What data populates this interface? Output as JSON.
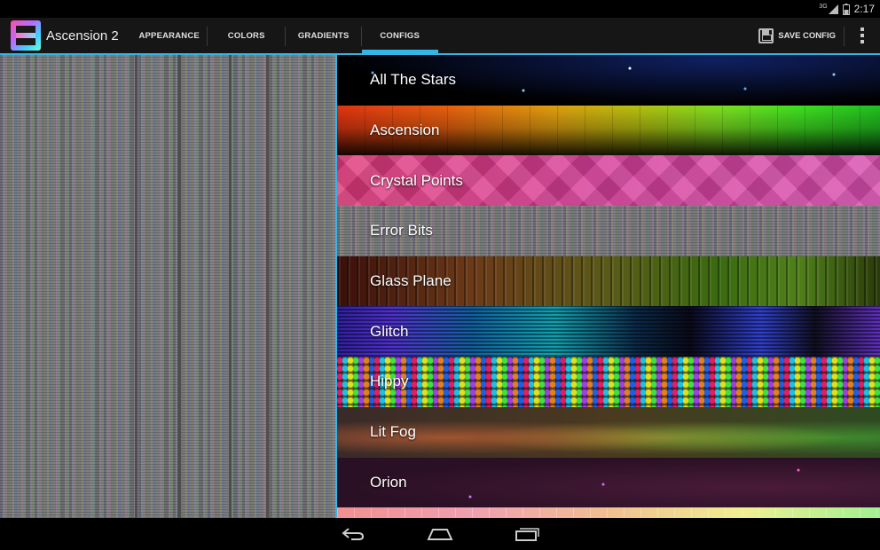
{
  "status_bar": {
    "network": "3G",
    "time": "2:17"
  },
  "action_bar": {
    "app_title": "Ascension 2",
    "tabs": [
      {
        "label": "APPEARANCE",
        "active": false
      },
      {
        "label": "COLORS",
        "active": false
      },
      {
        "label": "GRADIENTS",
        "active": false
      },
      {
        "label": "CONFIGS",
        "active": true
      }
    ],
    "save_label": "SAVE CONFIG",
    "accent_color": "#33b5e5"
  },
  "configs": [
    {
      "label": "All The Stars"
    },
    {
      "label": "Ascension"
    },
    {
      "label": "Crystal Points"
    },
    {
      "label": "Error Bits"
    },
    {
      "label": "Glass Plane"
    },
    {
      "label": "Glitch"
    },
    {
      "label": "Hippy"
    },
    {
      "label": "Lit Fog"
    },
    {
      "label": "Orion"
    }
  ],
  "icons": {
    "app": "app-icon",
    "save": "floppy-disk-icon",
    "overflow": "overflow-menu-icon",
    "back": "back-icon",
    "home": "home-icon",
    "recents": "recent-apps-icon"
  }
}
